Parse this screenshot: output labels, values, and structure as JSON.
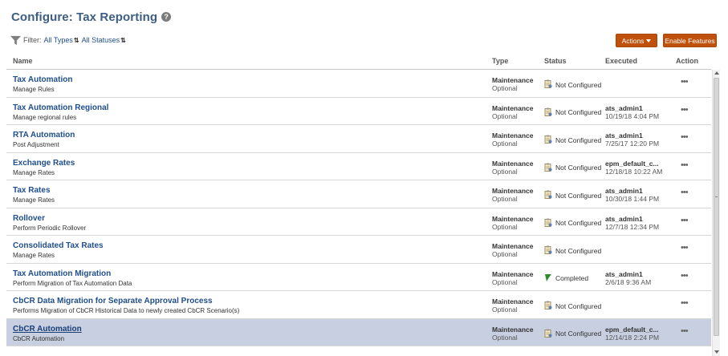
{
  "header": {
    "title": "Configure: Tax Reporting",
    "help_glyph": "?"
  },
  "filter": {
    "label": "Filter:",
    "types": "All Types",
    "statuses": "All Statuses",
    "sort_glyph": "⇅"
  },
  "toolbar": {
    "actions_label": "Actions",
    "enable_label": "Enable Features"
  },
  "columns": {
    "name": "Name",
    "type": "Type",
    "status": "Status",
    "executed": "Executed",
    "action": "Action"
  },
  "colors": {
    "accent_button": "#c0510d",
    "link": "#1f4e8c",
    "title": "#3d5e82",
    "selected_row": "#c8cfe0"
  },
  "rows": [
    {
      "name": "Tax Automation",
      "description": "Manage Rules",
      "type": "Maintenance",
      "subtype": "Optional",
      "status": "Not Configured",
      "status_icon": "clipboard-icon",
      "user": "",
      "date": "",
      "action": "•••"
    },
    {
      "name": "Tax Automation Regional",
      "description": "Manage regional rules",
      "type": "Maintenance",
      "subtype": "Optional",
      "status": "Not Configured",
      "status_icon": "clipboard-icon",
      "user": "ats_admin1",
      "date": "10/19/18 4:04 PM",
      "action": "•••"
    },
    {
      "name": "RTA Automation",
      "description": "Post Adjustment",
      "type": "Maintenance",
      "subtype": "Optional",
      "status": "Not Configured",
      "status_icon": "clipboard-icon",
      "user": "ats_admin1",
      "date": "7/25/17 12:20 PM",
      "action": "•••"
    },
    {
      "name": "Exchange Rates",
      "description": "Manage Rates",
      "type": "Maintenance",
      "subtype": "Optional",
      "status": "Not Configured",
      "status_icon": "clipboard-icon",
      "user": "epm_default_c...",
      "date": "12/18/18 10:22 AM",
      "action": "•••"
    },
    {
      "name": "Tax Rates",
      "description": "Manage Rates",
      "type": "Maintenance",
      "subtype": "Optional",
      "status": "Not Configured",
      "status_icon": "clipboard-icon",
      "user": "ats_admin1",
      "date": "10/30/18 1:44 PM",
      "action": "•••"
    },
    {
      "name": "Rollover",
      "description": "Perform Periodic Rollover",
      "type": "Maintenance",
      "subtype": "Optional",
      "status": "Not Configured",
      "status_icon": "clipboard-icon",
      "user": "ats_admin1",
      "date": "12/7/18 12:34 PM",
      "action": "•••"
    },
    {
      "name": "Consolidated Tax Rates",
      "description": "Manage Rates",
      "type": "Maintenance",
      "subtype": "Optional",
      "status": "Not Configured",
      "status_icon": "clipboard-icon",
      "user": "",
      "date": "",
      "action": "•••"
    },
    {
      "name": "Tax Automation Migration",
      "description": "Perform Migration of Tax Automation Data",
      "type": "Maintenance",
      "subtype": "Optional",
      "status": "Completed",
      "status_icon": "green-flag-icon",
      "user": "ats_admin1",
      "date": "2/6/18 9:36 AM",
      "action": "•••"
    },
    {
      "name": "CbCR Data Migration for Separate Approval Process",
      "description": "Performs Migration of CbCR Historical Data to newly created CbCR Scenario(s)",
      "type": "Maintenance",
      "subtype": "Optional",
      "status": "Not Configured",
      "status_icon": "clipboard-icon",
      "user": "",
      "date": "",
      "action": "•••"
    },
    {
      "name": "CbCR Automation",
      "description": "CbCR Automation",
      "type": "Maintenance",
      "subtype": "Optional",
      "status": "Not Configured",
      "status_icon": "clipboard-icon",
      "user": "epm_default_c...",
      "date": "12/14/18 2:24 PM",
      "action": "•••",
      "selected": true
    }
  ]
}
